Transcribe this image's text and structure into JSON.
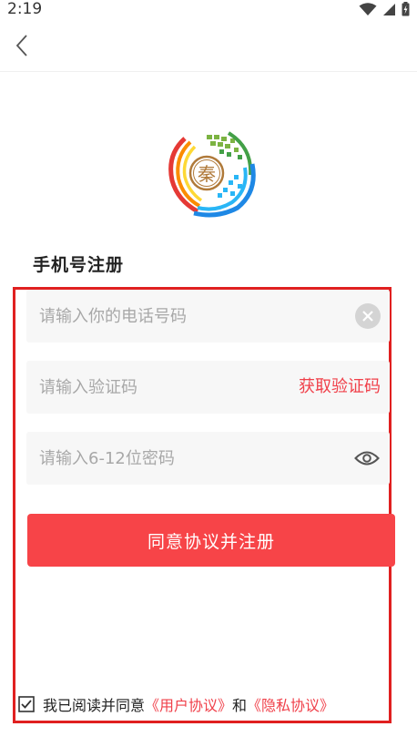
{
  "status_bar": {
    "time": "2:19",
    "icons": [
      "wifi-icon",
      "signal-icon",
      "battery-charging-icon"
    ]
  },
  "nav": {
    "back_icon": "chevron-left-icon"
  },
  "logo": {
    "text": "秦",
    "colors": [
      "#e53935",
      "#fb8c00",
      "#fdd835",
      "#7cb342",
      "#43a047",
      "#1e88e5",
      "#29b6f6",
      "#b07a3a"
    ]
  },
  "title": "手机号注册",
  "form": {
    "phone": {
      "placeholder": "请输入你的电话号码",
      "value": ""
    },
    "code": {
      "placeholder": "请输入验证码",
      "value": "",
      "get_code_label": "获取验证码"
    },
    "password": {
      "placeholder": "请输入6-12位密码",
      "value": ""
    },
    "submit_label": "同意协议并注册"
  },
  "agreement": {
    "checked": true,
    "prefix": "我已阅读并同意",
    "user_agreement": "《用户协议》",
    "conjunction": "和",
    "privacy_policy": "《隐私协议》"
  },
  "theme": {
    "accent": "#f74448",
    "link": "#f0404a",
    "highlight_border": "#e02020",
    "field_bg": "#f7f7f7"
  }
}
